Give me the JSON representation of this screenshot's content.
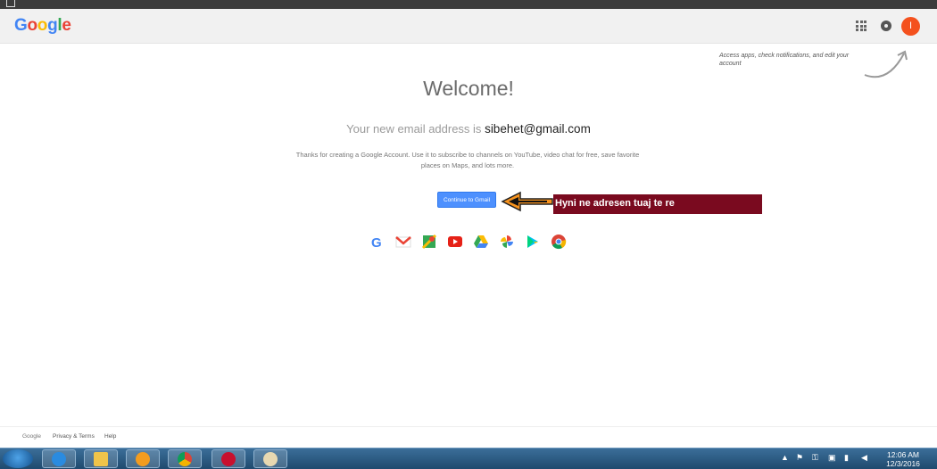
{
  "window": {
    "title_bar_icon": "window-icon"
  },
  "header": {
    "logo_letters": [
      {
        "char": "G",
        "color": "#4285f4"
      },
      {
        "char": "o",
        "color": "#ea4335"
      },
      {
        "char": "o",
        "color": "#fbbc05"
      },
      {
        "char": "g",
        "color": "#4285f4"
      },
      {
        "char": "l",
        "color": "#34a853"
      },
      {
        "char": "e",
        "color": "#ea4335"
      }
    ],
    "apps_icon": "apps-grid-icon",
    "notifications_icon": "notifications-icon",
    "avatar_letter": "I",
    "avatar_color": "#f4511e"
  },
  "hint": {
    "text": "Access apps, check notifications, and edit your account"
  },
  "main": {
    "welcome": "Welcome!",
    "email_prefix": "Your new email address is",
    "email_address": "sibehet@gmail.com",
    "description": "Thanks for creating a Google Account. Use it to subscribe to channels on YouTube, video chat for free, save favorite places on Maps, and lots more.",
    "cta_label": "Continue to Gmail",
    "cta_color": "#4d90fe"
  },
  "annotation": {
    "banner_text": "Hyni ne adresen tuaj te re",
    "banner_color": "#7a0a1f",
    "arrow_color": "#f7931e"
  },
  "products": [
    "google-search-icon",
    "gmail-icon",
    "maps-icon",
    "youtube-icon",
    "drive-icon",
    "photos-icon",
    "play-store-icon",
    "chrome-icon"
  ],
  "footer": {
    "brand": "Google",
    "privacy_terms": "Privacy & Terms",
    "help": "Help"
  },
  "taskbar": {
    "pinned": [
      "internet-explorer-icon",
      "file-explorer-icon",
      "media-player-icon",
      "chrome-icon",
      "app-red-icon",
      "paint-icon"
    ],
    "clock_time": "12:06 AM",
    "clock_date": "12/3/2016"
  }
}
